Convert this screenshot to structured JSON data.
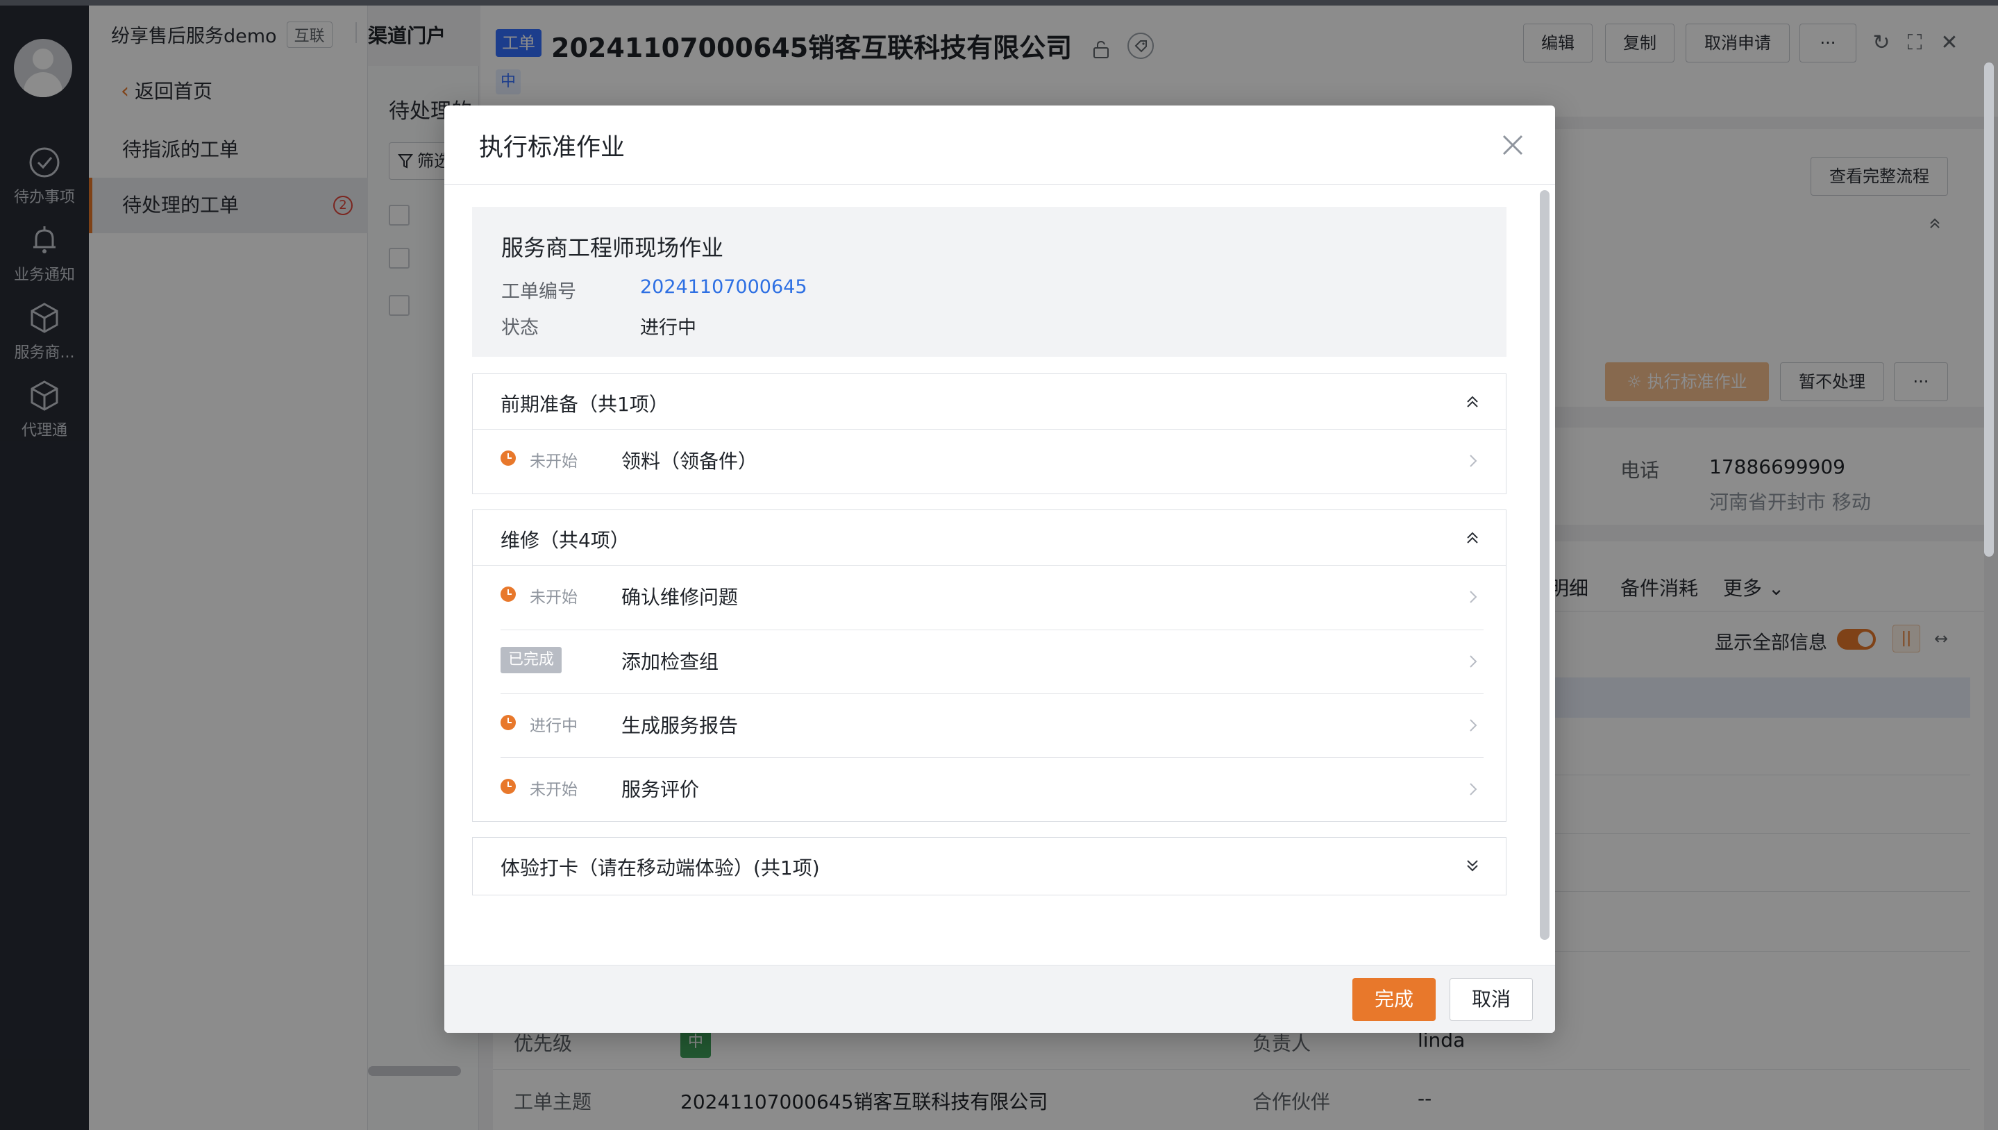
{
  "app": {
    "brand": "纷享售后服务demo",
    "brand_tag": "互联",
    "portal": "渠道门户"
  },
  "rail": {
    "items": [
      {
        "label": "待办事项",
        "icon": "check-circle-icon"
      },
      {
        "label": "业务通知",
        "icon": "bell-icon"
      },
      {
        "label": "服务商...",
        "icon": "box-icon"
      },
      {
        "label": "代理通",
        "icon": "box-icon"
      }
    ]
  },
  "nav": {
    "back_label": "返回首页",
    "items": [
      {
        "label": "待指派的工单"
      },
      {
        "label": "待处理的工单",
        "badge": "2"
      }
    ]
  },
  "list": {
    "title": "待处理的",
    "filter_label": "筛选"
  },
  "detail": {
    "type_tag": "工单",
    "title": "20241107000645销客互联科技有限公司",
    "priority_tag": "中",
    "actions": {
      "edit": "编辑",
      "copy": "复制",
      "cancel_request": "取消申请",
      "more": "···"
    },
    "view_flow": "查看完整流程",
    "execute_label": "执行标准作业",
    "hold_label": "暂不处理",
    "more_label": "···",
    "phone_label": "电话",
    "phone_value": "17886699909",
    "phone_location": "河南省开封市 移动",
    "tabs": [
      "明细",
      "备件消耗",
      "更多"
    ],
    "show_all_label": "显示全部信息",
    "fields": [
      {
        "label": "优先级",
        "value": "中",
        "label2": "负责人",
        "value2": "linda"
      },
      {
        "label": "工单主题",
        "value": "20241107000645销客互联科技有限公司",
        "label2": "合作伙伴",
        "value2": "--"
      }
    ]
  },
  "modal": {
    "title": "执行标准作业",
    "info": {
      "title": "服务商工程师现场作业",
      "order_no_label": "工单编号",
      "order_no_value": "20241107000645",
      "status_label": "状态",
      "status_value": "进行中"
    },
    "sections": [
      {
        "title": "前期准备（共1项）",
        "expanded": true,
        "tasks": [
          {
            "status": "未开始",
            "name": "领料（领备件）"
          }
        ]
      },
      {
        "title": "维修（共4项）",
        "expanded": true,
        "tasks": [
          {
            "status": "未开始",
            "name": "确认维修问题"
          },
          {
            "status": "已完成",
            "name": "添加检查组"
          },
          {
            "status": "进行中",
            "name": "生成服务报告"
          },
          {
            "status": "未开始",
            "name": "服务评价"
          }
        ]
      },
      {
        "title": "体验打卡（请在移动端体验）(共1项)",
        "expanded": false,
        "tasks": []
      }
    ],
    "confirm_label": "完成",
    "cancel_label": "取消"
  },
  "colors": {
    "accent": "#e8782b",
    "link": "#2d6fe3",
    "rail": "#282c36",
    "tag_blue": "#3370ff"
  }
}
